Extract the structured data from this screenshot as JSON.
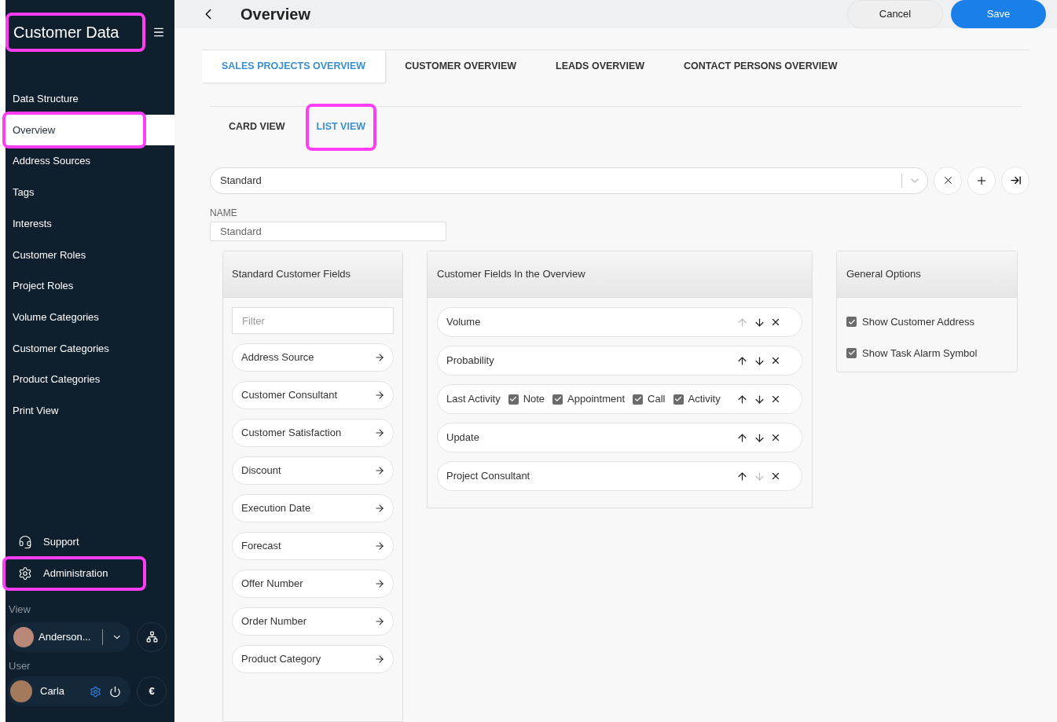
{
  "sidebar": {
    "title": "Customer Data",
    "title_highlighted": true,
    "items": [
      {
        "label": "Data Structure",
        "selected": false,
        "highlighted": false
      },
      {
        "label": "Overview",
        "selected": true,
        "highlighted": true
      },
      {
        "label": "Address Sources",
        "selected": false,
        "highlighted": false
      },
      {
        "label": "Tags",
        "selected": false,
        "highlighted": false
      },
      {
        "label": "Interests",
        "selected": false,
        "highlighted": false
      },
      {
        "label": "Customer Roles",
        "selected": false,
        "highlighted": false
      },
      {
        "label": "Project Roles",
        "selected": false,
        "highlighted": false
      },
      {
        "label": "Volume Categories",
        "selected": false,
        "highlighted": false
      },
      {
        "label": "Customer Categories",
        "selected": false,
        "highlighted": false
      },
      {
        "label": "Product Categories",
        "selected": false,
        "highlighted": false
      },
      {
        "label": "Print View",
        "selected": false,
        "highlighted": false
      }
    ],
    "bottom_items": [
      {
        "label": "Support",
        "kind": "support",
        "highlighted": false
      },
      {
        "label": "Administration",
        "kind": "settings",
        "highlighted": true
      }
    ],
    "view_label": "View",
    "view_user": "Anderson...",
    "user_label": "User",
    "user_name": "Carla",
    "currency": "€"
  },
  "header": {
    "title": "Overview",
    "cancel": "Cancel",
    "save": "Save"
  },
  "tabs": [
    {
      "label": "SALES PROJECTS OVERVIEW",
      "selected": true
    },
    {
      "label": "CUSTOMER OVERVIEW",
      "selected": false
    },
    {
      "label": "LEADS OVERVIEW",
      "selected": false
    },
    {
      "label": "CONTACT PERSONS OVERVIEW",
      "selected": false
    }
  ],
  "view_tabs": [
    {
      "label": "CARD VIEW",
      "selected": false,
      "highlighted": false
    },
    {
      "label": "LIST VIEW",
      "selected": true,
      "highlighted": true
    }
  ],
  "layout_select": {
    "value": "Standard"
  },
  "name_field": {
    "label": "NAME",
    "value": "Standard"
  },
  "standard_fields": {
    "title": "Standard Customer Fields",
    "filter_placeholder": "Filter",
    "items": [
      "Address Source",
      "Customer Consultant",
      "Customer Satisfaction",
      "Discount",
      "Execution Date",
      "Forecast",
      "Offer Number",
      "Order Number",
      "Product Category"
    ]
  },
  "overview_fields": {
    "title": "Customer Fields In the Overview",
    "items": [
      {
        "label": "Volume",
        "up_disabled": true,
        "down_disabled": false
      },
      {
        "label": "Probability",
        "up_disabled": false,
        "down_disabled": false
      },
      {
        "label": "Last Activity",
        "up_disabled": false,
        "down_disabled": false,
        "options": [
          {
            "label": "Note",
            "checked": true
          },
          {
            "label": "Appointment",
            "checked": true
          },
          {
            "label": "Call",
            "checked": true
          },
          {
            "label": "Activity",
            "checked": true
          }
        ]
      },
      {
        "label": "Update",
        "up_disabled": false,
        "down_disabled": false
      },
      {
        "label": "Project Consultant",
        "up_disabled": false,
        "down_disabled": true
      }
    ]
  },
  "general_options": {
    "title": "General Options",
    "items": [
      {
        "label": "Show Customer Address",
        "checked": true
      },
      {
        "label": "Show Task Alarm Symbol",
        "checked": true
      }
    ]
  }
}
